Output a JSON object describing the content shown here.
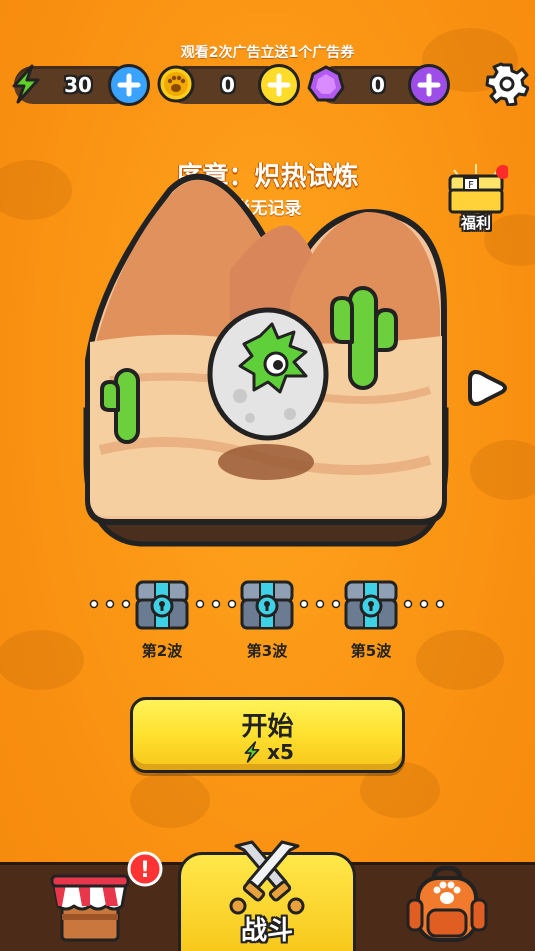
{
  "ad_banner": "观看2次广告立送1个广告券",
  "currencies": {
    "energy": {
      "icon": "lightning-icon",
      "value": "30"
    },
    "paw_coin": {
      "icon": "paw-coin-icon",
      "value": "0"
    },
    "gem": {
      "icon": "purple-gem-icon",
      "value": "0"
    }
  },
  "stage": {
    "title": "序章：炽热试炼",
    "record": "尚无记录"
  },
  "welfare": {
    "label": "福利",
    "has_notification": true
  },
  "wave_rewards": [
    {
      "label": "第2波",
      "icon": "locked-chest-icon"
    },
    {
      "label": "第3波",
      "icon": "locked-chest-icon"
    },
    {
      "label": "第5波",
      "icon": "locked-chest-icon"
    }
  ],
  "start_button": {
    "label": "开始",
    "cost": "x5",
    "cost_icon": "lightning-icon"
  },
  "bottom_nav": {
    "shop": {
      "icon": "shop-stall-icon",
      "alert": "!"
    },
    "battle": {
      "icon": "crossed-swords-icon",
      "label": "战斗"
    },
    "backpack": {
      "icon": "backpack-icon"
    }
  },
  "colors": {
    "background": "#f98f10",
    "currency_bar": "#5b3b22",
    "plus_blue": "#3aa3ff",
    "plus_yellow": "#ffdb2a",
    "plus_purple": "#9e4ee8",
    "start_yellow": "#ffe02e",
    "bottom_bar": "#4c2c19"
  }
}
